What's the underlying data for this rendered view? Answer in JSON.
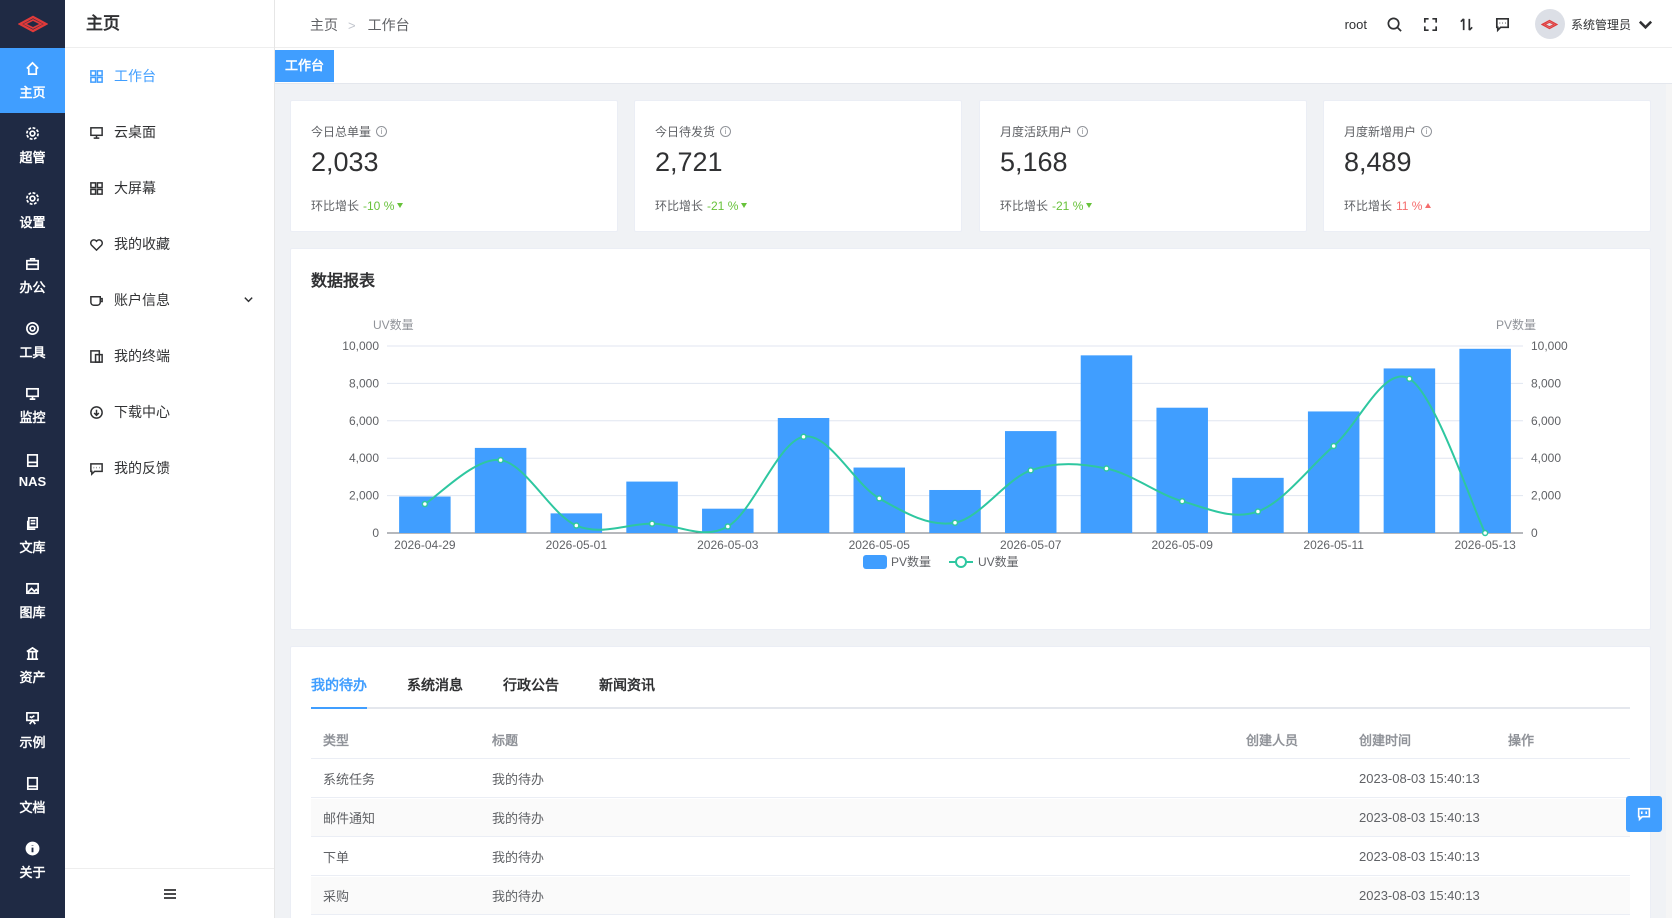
{
  "rail": {
    "items": [
      {
        "label": "主页",
        "icon": "home-icon"
      },
      {
        "label": "超管",
        "icon": "gear-icon"
      },
      {
        "label": "设置",
        "icon": "gear-icon"
      },
      {
        "label": "办公",
        "icon": "briefcase-icon"
      },
      {
        "label": "工具",
        "icon": "lifebuoy-icon"
      },
      {
        "label": "监控",
        "icon": "monitor-icon"
      },
      {
        "label": "NAS",
        "icon": "drive-icon"
      },
      {
        "label": "文库",
        "icon": "documents-icon"
      },
      {
        "label": "图库",
        "icon": "image-icon"
      },
      {
        "label": "资产",
        "icon": "bank-icon"
      },
      {
        "label": "示例",
        "icon": "easel-icon"
      },
      {
        "label": "文档",
        "icon": "book-icon"
      },
      {
        "label": "关于",
        "icon": "info-icon"
      }
    ]
  },
  "submenu": {
    "title": "主页",
    "items": [
      {
        "label": "工作台",
        "icon": "grid-icon"
      },
      {
        "label": "云桌面",
        "icon": "monitor-icon"
      },
      {
        "label": "大屏幕",
        "icon": "grid-icon"
      },
      {
        "label": "我的收藏",
        "icon": "heart-icon"
      },
      {
        "label": "账户信息",
        "icon": "cup-icon"
      },
      {
        "label": "我的终端",
        "icon": "devices-icon"
      },
      {
        "label": "下载中心",
        "icon": "download-icon"
      },
      {
        "label": "我的反馈",
        "icon": "feedback-icon"
      }
    ]
  },
  "header": {
    "breadcrumbs": [
      "主页",
      "工作台"
    ],
    "separator": ">",
    "username": "root",
    "role": "系统管理员"
  },
  "tagbar": {
    "active_tag": "工作台"
  },
  "stats": [
    {
      "label": "今日总单量",
      "value": "2,033",
      "trend_label": "环比增长",
      "trend": "-10 %",
      "direction": "down"
    },
    {
      "label": "今日待发货",
      "value": "2,721",
      "trend_label": "环比增长",
      "trend": "-21 %",
      "direction": "down"
    },
    {
      "label": "月度活跃用户",
      "value": "5,168",
      "trend_label": "环比增长",
      "trend": "-21 %",
      "direction": "down"
    },
    {
      "label": "月度新增用户",
      "value": "8,489",
      "trend_label": "环比增长",
      "trend": "11 %",
      "direction": "up"
    }
  ],
  "report": {
    "title": "数据报表"
  },
  "chart_data": {
    "type": "bar",
    "title": "",
    "categories": [
      "2026-04-29",
      "2026-04-30",
      "2026-05-01",
      "2026-05-02",
      "2026-05-03",
      "2026-05-04",
      "2026-05-05",
      "2026-05-06",
      "2026-05-07",
      "2026-05-08",
      "2026-05-09",
      "2026-05-10",
      "2026-05-11",
      "2026-05-12",
      "2026-05-13"
    ],
    "x_tick_labels": [
      "2026-04-29",
      "2026-05-01",
      "2026-05-03",
      "2026-05-05",
      "2026-05-07",
      "2026-05-09",
      "2026-05-11",
      "2026-05-13"
    ],
    "left_axis": {
      "label": "UV数量",
      "ylim": [
        0,
        10000
      ],
      "ticks": [
        "0",
        "2,000",
        "4,000",
        "6,000",
        "8,000",
        "10,000"
      ]
    },
    "right_axis": {
      "label": "PV数量",
      "ylim": [
        0,
        10000
      ],
      "ticks": [
        "0",
        "2,000",
        "4,000",
        "6,000",
        "8,000",
        "10,000"
      ]
    },
    "series": [
      {
        "name": "PV数量",
        "kind": "bar",
        "color": "#409eff",
        "values": [
          1950,
          4550,
          1050,
          2750,
          1300,
          6150,
          3500,
          2300,
          5450,
          9500,
          6700,
          2950,
          6500,
          8800,
          9850
        ]
      },
      {
        "name": "UV数量",
        "kind": "line",
        "color": "#2ec7a0",
        "values": [
          1550,
          3900,
          400,
          500,
          350,
          5150,
          1850,
          550,
          3350,
          3450,
          1700,
          1150,
          4650,
          8250,
          0
        ]
      }
    ],
    "legend": "bottom-center",
    "grid": true
  },
  "tasks": {
    "tabs": [
      "我的待办",
      "系统消息",
      "行政公告",
      "新闻资讯"
    ],
    "active_tab": 0,
    "columns": [
      "类型",
      "标题",
      "创建人员",
      "创建时间",
      "操作"
    ],
    "rows": [
      {
        "type": "系统任务",
        "title": "我的待办",
        "creator": "",
        "time": "2023-08-03 15:40:13",
        "action": ""
      },
      {
        "type": "邮件通知",
        "title": "我的待办",
        "creator": "",
        "time": "2023-08-03 15:40:13",
        "action": ""
      },
      {
        "type": "下单",
        "title": "我的待办",
        "creator": "",
        "time": "2023-08-03 15:40:13",
        "action": ""
      },
      {
        "type": "采购",
        "title": "我的待办",
        "creator": "",
        "time": "2023-08-03 15:40:13",
        "action": ""
      }
    ]
  }
}
